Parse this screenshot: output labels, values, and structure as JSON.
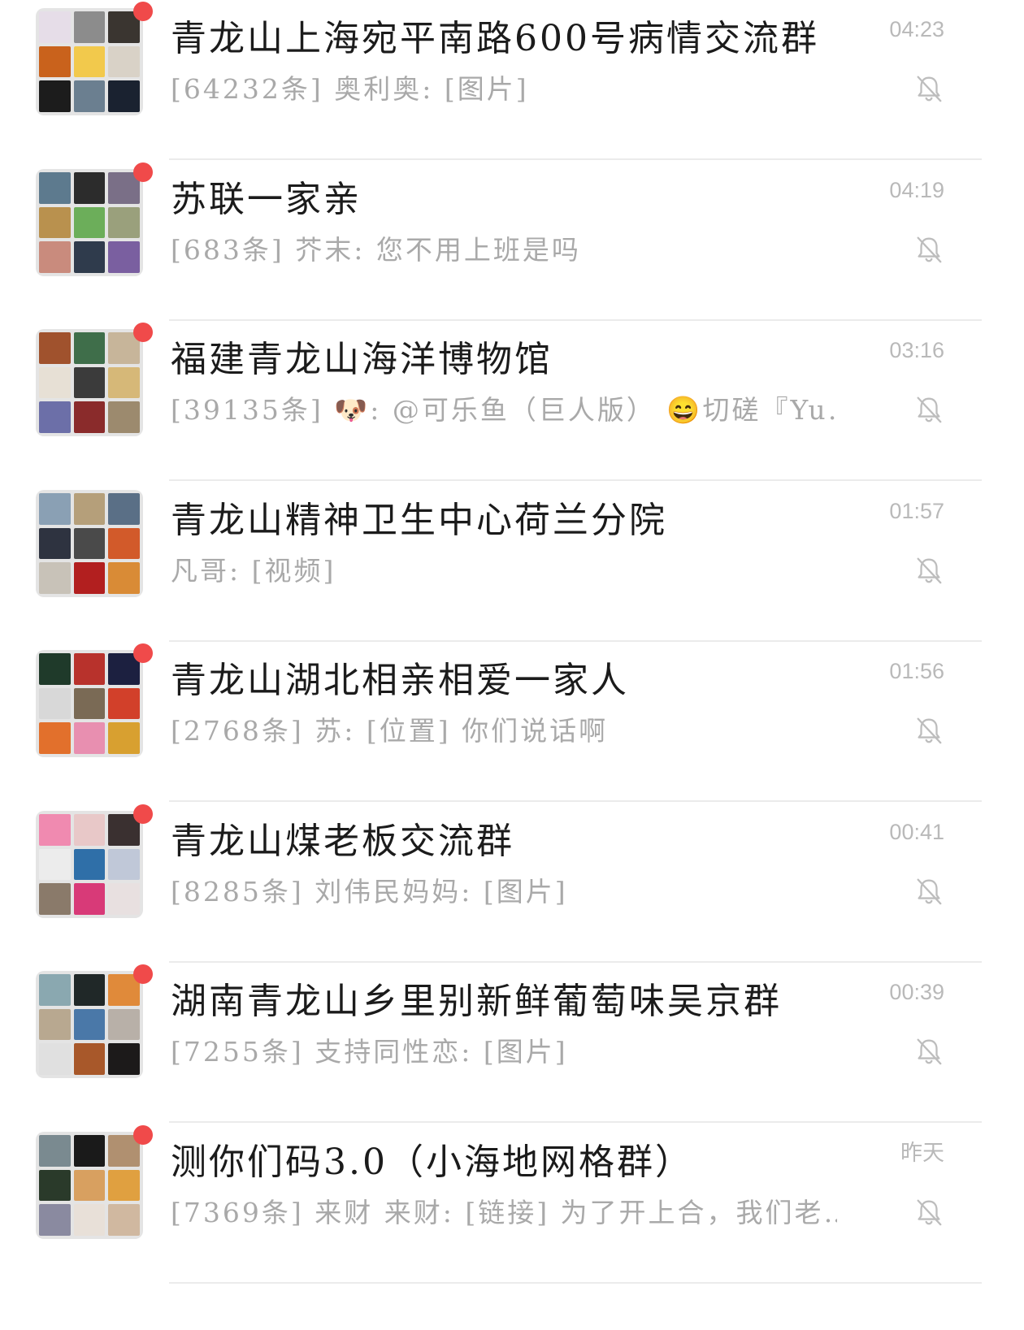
{
  "chats": [
    {
      "name": "青龙山上海宛平南路600号病情交流群",
      "preview": "[64232条] 奥利奥: [图片]",
      "time": "04:23",
      "unread": true,
      "muted": true,
      "icon": "bell-off-icon",
      "avatar_colors": [
        "#e6dde8",
        "#8c8c8c",
        "#3a3530",
        "#c9621c",
        "#f2c94c",
        "#d9d2c7",
        "#1c1c1c",
        "#6b7f90",
        "#1a2230"
      ]
    },
    {
      "name": "苏联一家亲",
      "preview": "[683条] 芥末: 您不用上班是吗",
      "time": "04:19",
      "unread": true,
      "muted": true,
      "icon": "bell-off-icon",
      "avatar_colors": [
        "#5d7a8e",
        "#2c2c2c",
        "#7a6f87",
        "#b9914e",
        "#6cae5a",
        "#9aa07c",
        "#c98b7d",
        "#2f3b4c",
        "#7a5fa0"
      ]
    },
    {
      "name": "福建青龙山海洋博物馆",
      "preview": "[39135条] 🐶: @可乐鱼（巨人版） 😄切磋『Yu…",
      "time": "03:16",
      "unread": true,
      "muted": true,
      "icon": "bell-off-icon",
      "avatar_colors": [
        "#a0522d",
        "#3f6e4a",
        "#c7b59a",
        "#e7e0d5",
        "#3b3b3b",
        "#d6b878",
        "#6c6fa8",
        "#8a2b2b",
        "#9c8a6e"
      ]
    },
    {
      "name": "青龙山精神卫生中心荷兰分院",
      "preview": "凡哥: [视频]",
      "time": "01:57",
      "unread": false,
      "muted": true,
      "icon": "bell-off-icon",
      "avatar_colors": [
        "#8aa0b4",
        "#b59f7a",
        "#5a6f86",
        "#2e3340",
        "#4a4a4a",
        "#d25a2a",
        "#c8c2b8",
        "#b21f1f",
        "#d98b36"
      ]
    },
    {
      "name": "青龙山湖北相亲相爱一家人",
      "preview": "[2768条] 苏: [位置] 你们说话啊",
      "time": "01:56",
      "unread": true,
      "muted": true,
      "icon": "bell-off-icon",
      "avatar_colors": [
        "#1f3a2a",
        "#b8322c",
        "#1c2040",
        "#d8d8d8",
        "#7a6a55",
        "#d2402a",
        "#e2702c",
        "#e88fb0",
        "#d8a030"
      ]
    },
    {
      "name": "青龙山煤老板交流群",
      "preview": "[8285条] 刘伟民妈妈: [图片]",
      "time": "00:41",
      "unread": true,
      "muted": true,
      "icon": "bell-off-icon",
      "avatar_colors": [
        "#f08ab0",
        "#e8c8c8",
        "#3a3030",
        "#ececec",
        "#2f6fa8",
        "#c0c8d8",
        "#8a7a6a",
        "#d83a78",
        "#e8e0e0"
      ]
    },
    {
      "name": "湖南青龙山乡里别新鲜葡萄味吴京群",
      "preview": "[7255条] 支持同性恋: [图片]",
      "time": "00:39",
      "unread": true,
      "muted": true,
      "icon": "bell-off-icon",
      "avatar_colors": [
        "#8aa8b0",
        "#202828",
        "#e08a3a",
        "#b8a890",
        "#4a78a8",
        "#b8b0a8",
        "#e0e0e0",
        "#a8582a",
        "#1c1a1a"
      ]
    },
    {
      "name": "测你们码3.0（小海地网格群）",
      "preview": "[7369条] 来财 来财: [链接] 为了开上合，我们老…",
      "time": "昨天",
      "unread": true,
      "muted": true,
      "icon": "bell-off-icon",
      "avatar_colors": [
        "#7a8a90",
        "#1a1a1a",
        "#b09070",
        "#2a3a2a",
        "#d8a060",
        "#e0a040",
        "#8a8aa0",
        "#e8e0d8",
        "#d0b8a0"
      ]
    }
  ]
}
